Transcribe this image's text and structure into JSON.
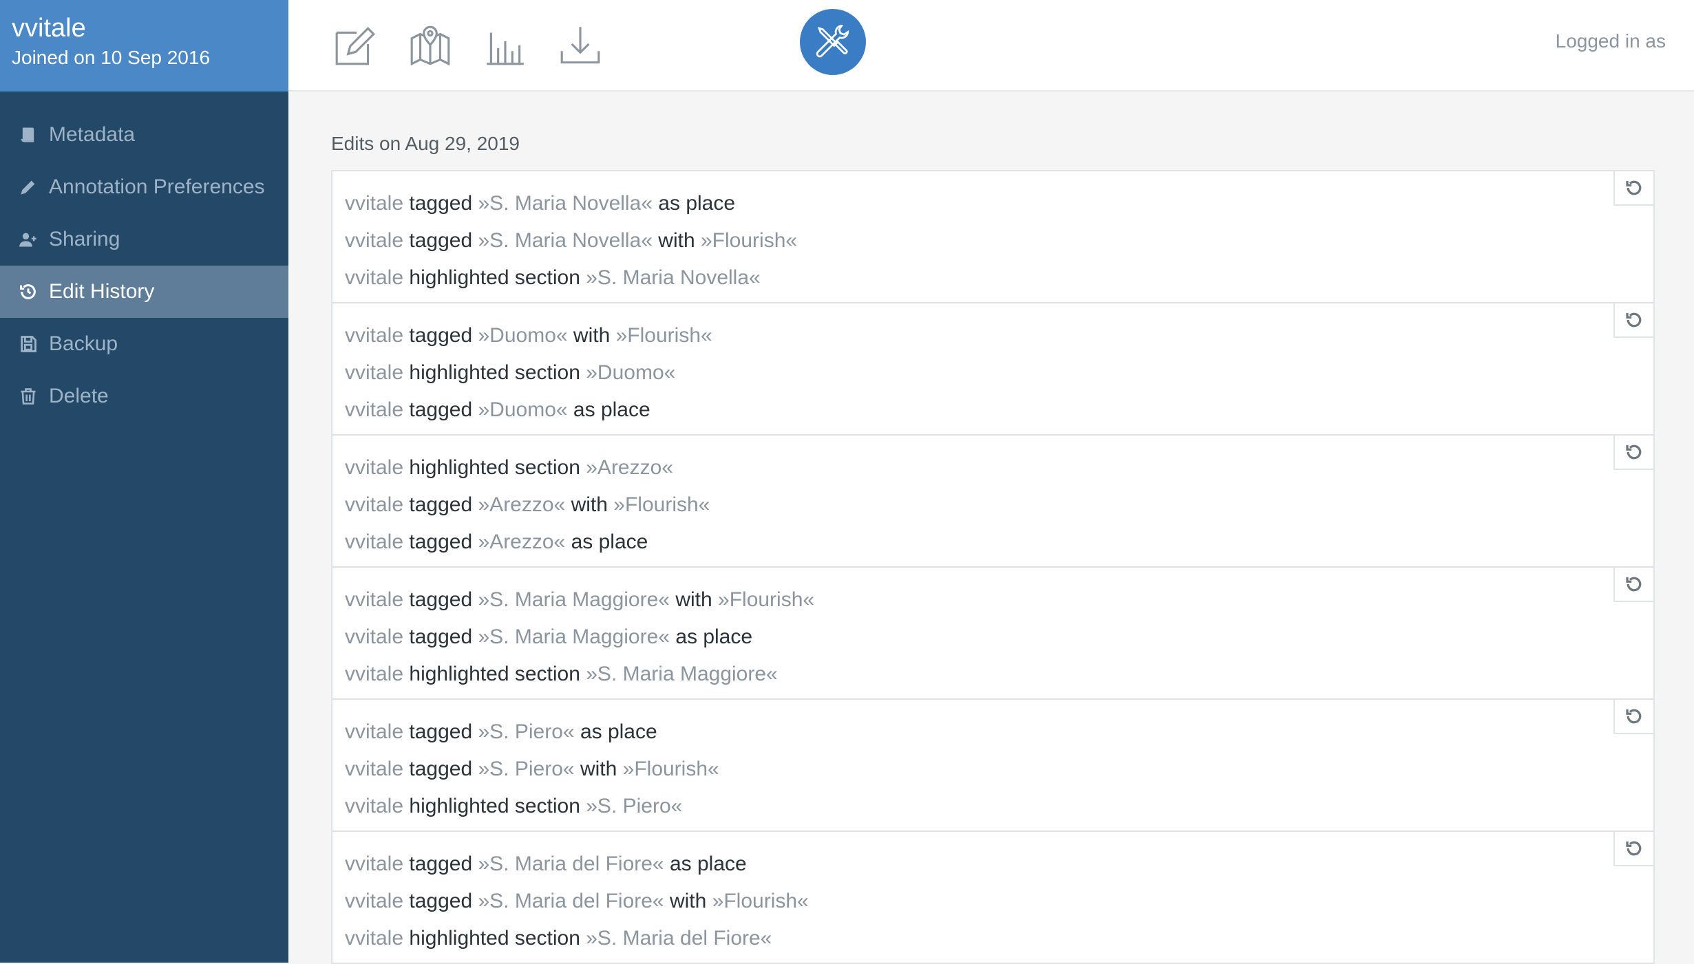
{
  "profile": {
    "username": "vvitale",
    "joined": "Joined on 10 Sep 2016"
  },
  "sidebar": {
    "items": [
      {
        "label": "Metadata",
        "icon": "book-icon"
      },
      {
        "label": "Annotation Preferences",
        "icon": "pencil-icon"
      },
      {
        "label": "Sharing",
        "icon": "user-plus-icon"
      },
      {
        "label": "Edit History",
        "icon": "history-icon",
        "active": true
      },
      {
        "label": "Backup",
        "icon": "floppy-icon"
      },
      {
        "label": "Delete",
        "icon": "trash-icon"
      }
    ]
  },
  "topbar": {
    "icons": [
      "edit-document-icon",
      "map-icon",
      "bar-chart-icon",
      "download-icon",
      "tools-icon"
    ],
    "active_icon": "tools-icon",
    "logged_in": "Logged in as"
  },
  "colors": {
    "sidebar": "#234868",
    "profile": "#4a88c8",
    "active_item": "#5f7d98",
    "accent": "#3a7dc4"
  },
  "edits": {
    "date_label": "Edits on Aug 29, 2019",
    "groups": [
      {
        "entries": [
          {
            "user": "vvitale",
            "action": "tagged",
            "target": "»S. Maria Novella«",
            "with_word": "",
            "with_target": "",
            "suffix": "as place"
          },
          {
            "user": "vvitale",
            "action": "tagged",
            "target": "»S. Maria Novella«",
            "with_word": "with",
            "with_target": "»Flourish«",
            "suffix": ""
          },
          {
            "user": "vvitale",
            "action": "highlighted section",
            "target": "»S. Maria Novella«",
            "with_word": "",
            "with_target": "",
            "suffix": ""
          }
        ]
      },
      {
        "entries": [
          {
            "user": "vvitale",
            "action": "tagged",
            "target": "»Duomo«",
            "with_word": "with",
            "with_target": "»Flourish«",
            "suffix": ""
          },
          {
            "user": "vvitale",
            "action": "highlighted section",
            "target": "»Duomo«",
            "with_word": "",
            "with_target": "",
            "suffix": ""
          },
          {
            "user": "vvitale",
            "action": "tagged",
            "target": "»Duomo«",
            "with_word": "",
            "with_target": "",
            "suffix": "as place"
          }
        ]
      },
      {
        "entries": [
          {
            "user": "vvitale",
            "action": "highlighted section",
            "target": "»Arezzo«",
            "with_word": "",
            "with_target": "",
            "suffix": ""
          },
          {
            "user": "vvitale",
            "action": "tagged",
            "target": "»Arezzo«",
            "with_word": "with",
            "with_target": "»Flourish«",
            "suffix": ""
          },
          {
            "user": "vvitale",
            "action": "tagged",
            "target": "»Arezzo«",
            "with_word": "",
            "with_target": "",
            "suffix": "as place"
          }
        ]
      },
      {
        "entries": [
          {
            "user": "vvitale",
            "action": "tagged",
            "target": "»S. Maria Maggiore«",
            "with_word": "with",
            "with_target": "»Flourish«",
            "suffix": ""
          },
          {
            "user": "vvitale",
            "action": "tagged",
            "target": "»S. Maria Maggiore«",
            "with_word": "",
            "with_target": "",
            "suffix": "as place"
          },
          {
            "user": "vvitale",
            "action": "highlighted section",
            "target": "»S. Maria Maggiore«",
            "with_word": "",
            "with_target": "",
            "suffix": ""
          }
        ]
      },
      {
        "entries": [
          {
            "user": "vvitale",
            "action": "tagged",
            "target": "»S. Piero«",
            "with_word": "",
            "with_target": "",
            "suffix": "as place"
          },
          {
            "user": "vvitale",
            "action": "tagged",
            "target": "»S. Piero«",
            "with_word": "with",
            "with_target": "»Flourish«",
            "suffix": ""
          },
          {
            "user": "vvitale",
            "action": "highlighted section",
            "target": "»S. Piero«",
            "with_word": "",
            "with_target": "",
            "suffix": ""
          }
        ]
      },
      {
        "entries": [
          {
            "user": "vvitale",
            "action": "tagged",
            "target": "»S. Maria del Fiore«",
            "with_word": "",
            "with_target": "",
            "suffix": "as place"
          },
          {
            "user": "vvitale",
            "action": "tagged",
            "target": "»S. Maria del Fiore«",
            "with_word": "with",
            "with_target": "»Flourish«",
            "suffix": ""
          },
          {
            "user": "vvitale",
            "action": "highlighted section",
            "target": "»S. Maria del Fiore«",
            "with_word": "",
            "with_target": "",
            "suffix": ""
          }
        ]
      }
    ]
  }
}
